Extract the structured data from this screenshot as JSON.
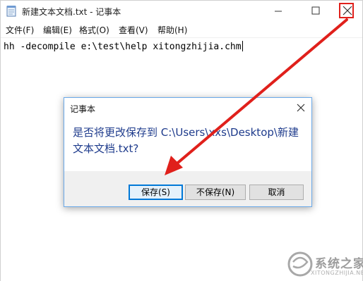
{
  "window": {
    "title": "新建文本文档.txt - 记事本"
  },
  "menubar": {
    "items": [
      "文件(F)",
      "编辑(E)",
      "格式(O)",
      "查看(V)",
      "帮助(H)"
    ]
  },
  "editor": {
    "content": "hh -decompile e:\\test\\help xitongzhijia.chm"
  },
  "dialog": {
    "title": "记事本",
    "message": "是否将更改保存到 C:\\Users\\xxs\\Desktop\\新建文本文档.txt?",
    "buttons": {
      "save": "保存(S)",
      "dont_save": "不保存(N)",
      "cancel": "取消"
    }
  },
  "watermark": {
    "text": "系统之家",
    "subtext": "XITONGZHIJIA.NET"
  },
  "colors": {
    "highlight_red": "#e0201b",
    "dialog_text_blue": "#1e3b8c",
    "default_button_border": "#0078d7"
  }
}
